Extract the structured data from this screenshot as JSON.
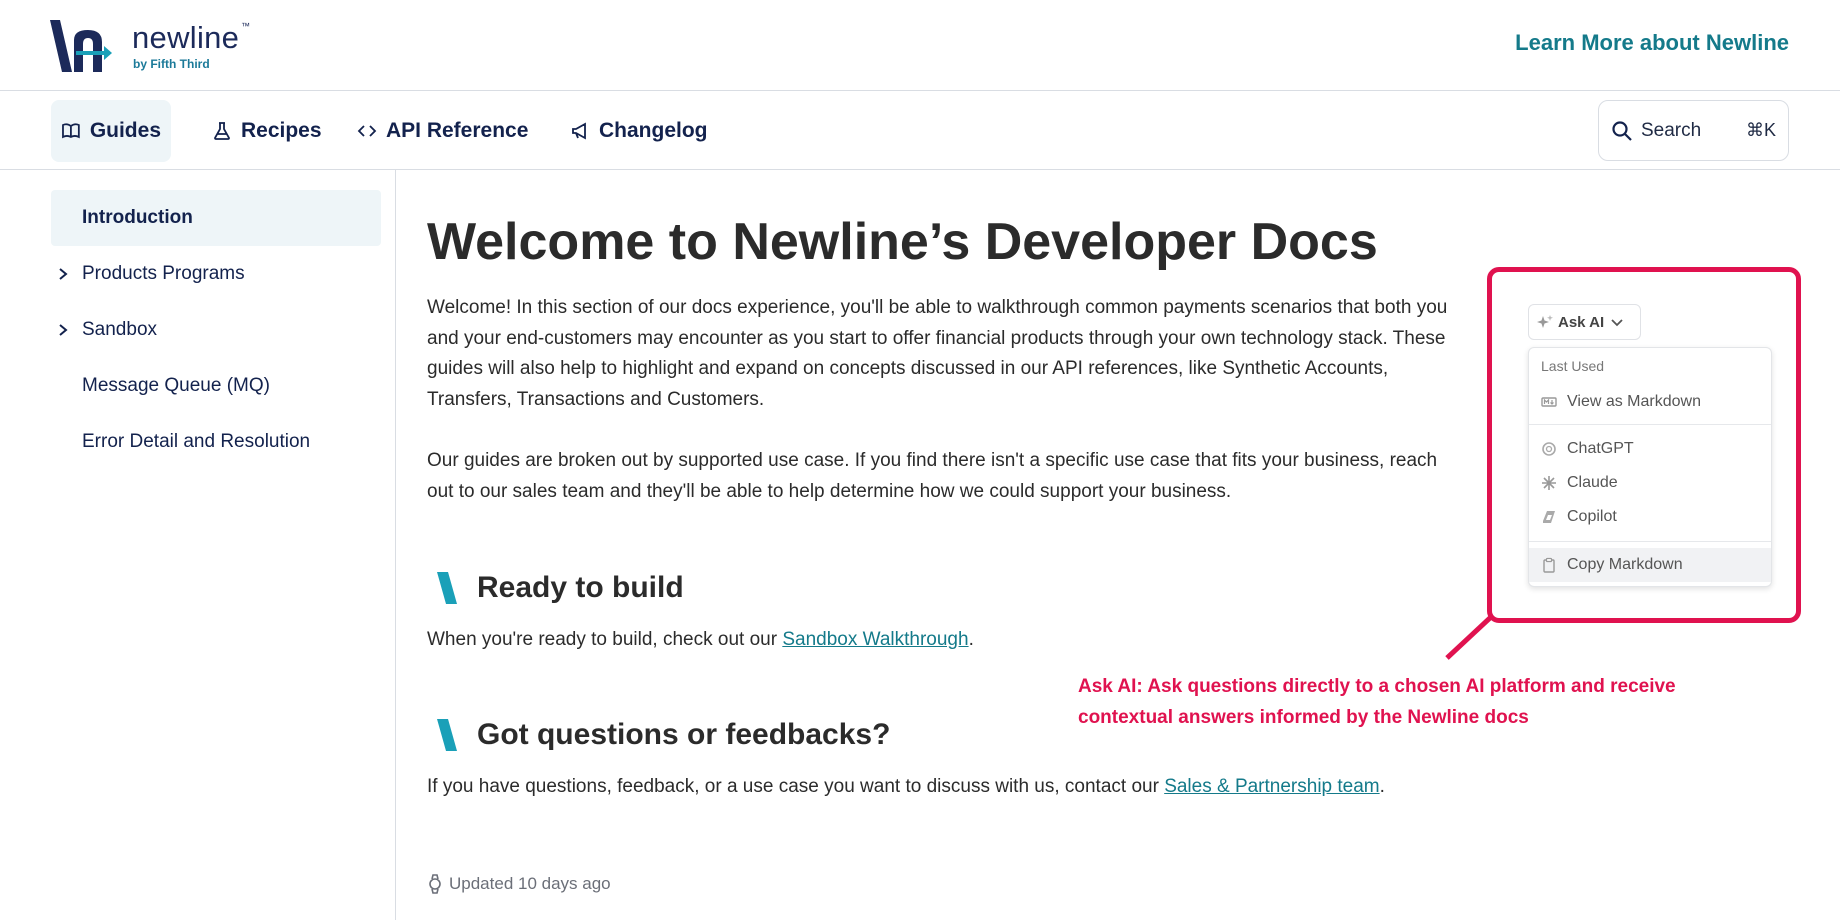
{
  "header": {
    "logo_word": "newline",
    "logo_tm": "™",
    "logo_sub": "by Fifth Third",
    "learn_more": "Learn More about Newline"
  },
  "nav": {
    "tabs": [
      {
        "label": "Guides",
        "icon": "book-icon",
        "active": true
      },
      {
        "label": "Recipes",
        "icon": "flask-icon",
        "active": false
      },
      {
        "label": "API Reference",
        "icon": "code-icon",
        "active": false
      },
      {
        "label": "Changelog",
        "icon": "megaphone-icon",
        "active": false
      }
    ],
    "search": {
      "label": "Search",
      "shortcut": "⌘K",
      "icon": "search-icon"
    }
  },
  "sidebar": {
    "items": [
      {
        "label": "Introduction",
        "active": true,
        "expandable": false
      },
      {
        "label": "Products Programs",
        "active": false,
        "expandable": true
      },
      {
        "label": "Sandbox",
        "active": false,
        "expandable": true
      },
      {
        "label": "Message Queue (MQ)",
        "active": false,
        "expandable": false
      },
      {
        "label": "Error Detail and Resolution",
        "active": false,
        "expandable": false
      }
    ]
  },
  "main": {
    "title": "Welcome to Newline’s Developer Docs",
    "intro_p1": "Welcome! In this section of our docs experience, you'll be able to walkthrough common payments scenarios that both you and your end-customers may encounter as you start to offer financial products through your own technology stack. These guides will also help to highlight and expand on concepts discussed in our API references, like Synthetic Accounts, Transfers, Transactions and Customers.",
    "intro_p2": "Our guides are broken out by supported use case. If you find there isn't a specific use case that fits your business, reach out to our sales team and they'll be able to help determine how we could support your business.",
    "ready": {
      "heading": "Ready to build",
      "text_before": "When you're ready to build, check out our ",
      "link": "Sandbox Walkthrough",
      "text_after": "."
    },
    "questions": {
      "heading": "Got questions or feedbacks?",
      "text_before": "If you have questions, feedback, or a use case you want to discuss with us, contact our ",
      "link": "Sales & Partnership team",
      "text_after": "."
    },
    "updated": "Updated 10 days ago"
  },
  "ask_ai": {
    "button_label": "Ask AI",
    "section_label": "Last Used",
    "items": [
      {
        "label": "View as Markdown",
        "icon": "markdown-icon"
      },
      {
        "label": "ChatGPT",
        "icon": "chatgpt-icon"
      },
      {
        "label": "Claude",
        "icon": "claude-icon"
      },
      {
        "label": "Copilot",
        "icon": "copilot-icon"
      },
      {
        "label": "Copy Markdown",
        "icon": "clipboard-icon"
      }
    ],
    "annotation": "Ask AI: Ask questions directly to a chosen AI platform and receive contextual answers informed by the Newline docs",
    "annotation_color": "#e0124f"
  },
  "colors": {
    "brand_navy": "#13224d",
    "brand_teal": "#147a8a",
    "accent_teal": "#1aa0b8",
    "annotation_red": "#e0124f"
  }
}
